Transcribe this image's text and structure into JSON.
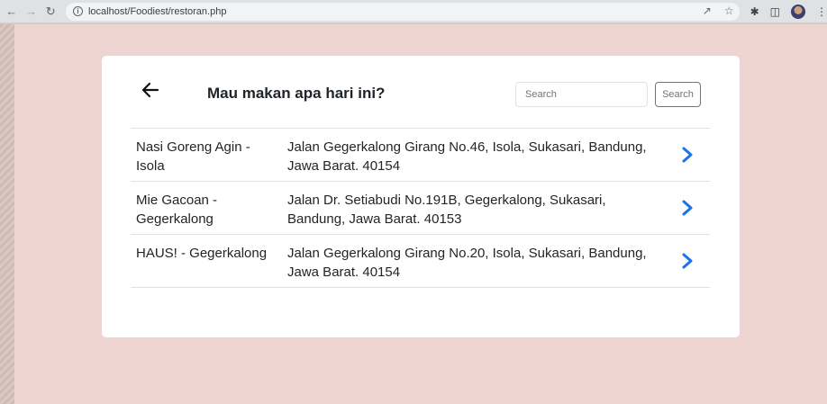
{
  "browser": {
    "url": "localhost/Foodiest/restoran.php",
    "back_icon": "arrow-left-icon",
    "forward_icon": "arrow-right-icon",
    "reload_icon": "reload-icon",
    "info_icon": "info-icon"
  },
  "header": {
    "title": "Mau makan apa hari ini?",
    "back_icon": "arrow-left-icon",
    "search": {
      "placeholder": "Search",
      "value": "",
      "button_label": "Search"
    }
  },
  "restaurants": [
    {
      "name": "Nasi Goreng Agin - Isola",
      "address": "Jalan Gegerkalong Girang No.46, Isola, Sukasari, Bandung, Jawa Barat. 40154"
    },
    {
      "name": "Mie Gacoan - Gegerkalong",
      "address": "Jalan Dr. Setiabudi No.191B, Gegerkalong, Sukasari, Bandung, Jawa Barat. 40153"
    },
    {
      "name": "HAUS! - Gegerkalong",
      "address": "Jalan Gegerkalong Girang No.20, Isola, Sukasari, Bandung, Jawa Barat. 40154"
    }
  ],
  "colors": {
    "accent": "#1a73e8",
    "page_background": "#eed4d1",
    "card_background": "#ffffff",
    "text": "#212529"
  }
}
